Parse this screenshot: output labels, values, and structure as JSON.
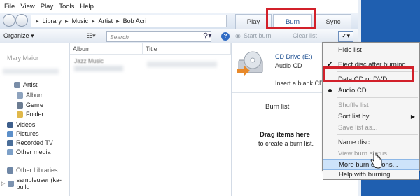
{
  "menubar": [
    "File",
    "View",
    "Play",
    "Tools",
    "Help"
  ],
  "breadcrumb": [
    "Library",
    "Music",
    "Artist",
    "Bob Acri"
  ],
  "tabs": {
    "play": "Play",
    "burn": "Burn",
    "sync": "Sync"
  },
  "toolbar": {
    "organize": "Organize ▾",
    "search_placeholder": "Search",
    "start_burn": "Start burn",
    "clear_list": "Clear list"
  },
  "navpane": {
    "user": "Mary Maior",
    "items": [
      "Artist",
      "Album",
      "Genre",
      "Folder"
    ],
    "groups": [
      "Videos",
      "Pictures",
      "Recorded TV",
      "Other media"
    ],
    "other_libraries": "Other Libraries",
    "sampleuser": "sampleuser (ka-build"
  },
  "content": {
    "columns": [
      "Album",
      "Title"
    ],
    "album_row": "Jazz Music"
  },
  "burnpane": {
    "drive": "CD Drive (E:)",
    "disc_type": "Audio CD",
    "insert": "Insert a blank CD",
    "burn_list": "Burn list",
    "drag_line1": "Drag items here",
    "drag_line2": "to create a burn list."
  },
  "dropdown": {
    "hide_list": "Hide list",
    "eject": "Eject disc after burning",
    "data_cd": "Data CD or DVD",
    "audio_cd": "Audio CD",
    "shuffle": "Shuffle list",
    "sort": "Sort list by",
    "save": "Save list as...",
    "name_disc": "Name disc",
    "view_status": "View burn status",
    "more_options": "More burn options...",
    "help": "Help with burning..."
  },
  "colors": {
    "highlight": "#d2202a",
    "accent": "#1f5fb0",
    "hover": "#cde3fa"
  }
}
